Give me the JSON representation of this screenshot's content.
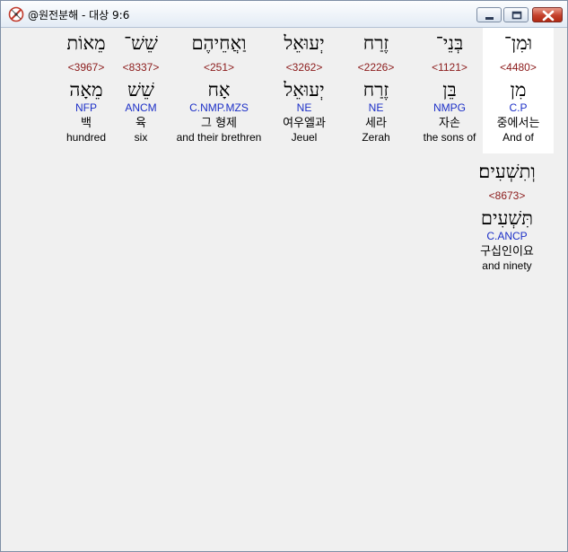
{
  "window": {
    "title": "@원전분해 - 대상 9:6"
  },
  "colors": {
    "strong_number": "#8b1a1a",
    "parsing_code": "#1c2fc7",
    "selected_background": "#ffffff",
    "panel_background": "#f0f0f0"
  },
  "words": [
    {
      "original": "וּמִן־",
      "strong": "<4480>",
      "lemma": "מִן",
      "parsing": "C.P",
      "korean": "중에서는",
      "english": "And of",
      "selected": true
    },
    {
      "original": "בְּנֵי־",
      "strong": "<1121>",
      "lemma": "בֵּן",
      "parsing": "NMPG",
      "korean": "자손",
      "english": "the sons of",
      "selected": false
    },
    {
      "original": "זֶרַח",
      "strong": "<2226>",
      "lemma": "זֶרַח",
      "parsing": "NE",
      "korean": "세라",
      "english": "Zerah",
      "selected": false
    },
    {
      "original": "יְעוּאֵל",
      "strong": "<3262>",
      "lemma": "יְעוּאֵל",
      "parsing": "NE",
      "korean": "여우엘과",
      "english": "Jeuel",
      "selected": false
    },
    {
      "original": "וַאֲחֵיהֶם",
      "strong": "<251>",
      "lemma": "אָח",
      "parsing": "C.NMP.MZS",
      "korean": "그 형제",
      "english": "and their brethren",
      "selected": false
    },
    {
      "original": "שֵׁשׁ־",
      "strong": "<8337>",
      "lemma": "שֵׁשׁ",
      "parsing": "ANCM",
      "korean": "육",
      "english": "six",
      "selected": false
    },
    {
      "original": "מֵאוֹת",
      "strong": "<3967>",
      "lemma": "מֵאָה",
      "parsing": "NFP",
      "korean": "백",
      "english": "hundred",
      "selected": false
    },
    {
      "original": "וְתִשְׁעִים׃",
      "strong": "<8673>",
      "lemma": "תִּשְׁעִים",
      "parsing": "C.ANCP",
      "korean": "구십인이요",
      "english": "and ninety",
      "selected": false
    }
  ]
}
